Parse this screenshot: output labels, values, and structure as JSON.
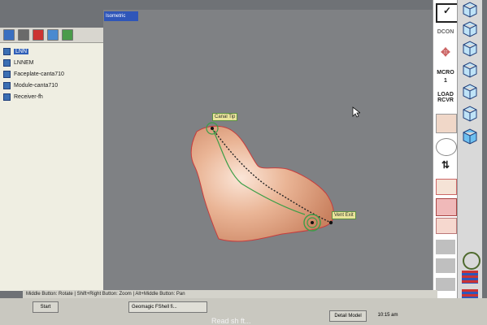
{
  "viewport": {
    "view_name": "Isometric",
    "markers": {
      "canal_tip": "Canal Tip",
      "vent_exit": "Vent Exit"
    }
  },
  "tree": {
    "items": [
      {
        "label": "LNN",
        "selected": true
      },
      {
        "label": "LNNEM",
        "selected": false
      },
      {
        "label": "Faceplate-canta710",
        "selected": false
      },
      {
        "label": "Module-canta710",
        "selected": false
      },
      {
        "label": "Receiver-fh",
        "selected": false
      }
    ]
  },
  "right_toolbar": {
    "decon_label": "DCON",
    "micro_label": "MCRO",
    "micro_value": "1",
    "load_rcvr_label": "LOAD\nRCVR"
  },
  "status_bar": {
    "hint": "Middle Button: Rotate | Shift+Right Button: Zoom | Alt+Middle Button: Pan"
  },
  "taskbar": {
    "start_label": "Start",
    "task_label": "Geomagic FShell fi...",
    "detail_label": "Detail Model",
    "clock": "10:15 am"
  },
  "caption": "Read sh ft...",
  "colors": {
    "viewport_bg": "#7f8184",
    "model_fill": "#eab596",
    "path_line": "#3b9e47",
    "accent": "#2f56b9"
  }
}
